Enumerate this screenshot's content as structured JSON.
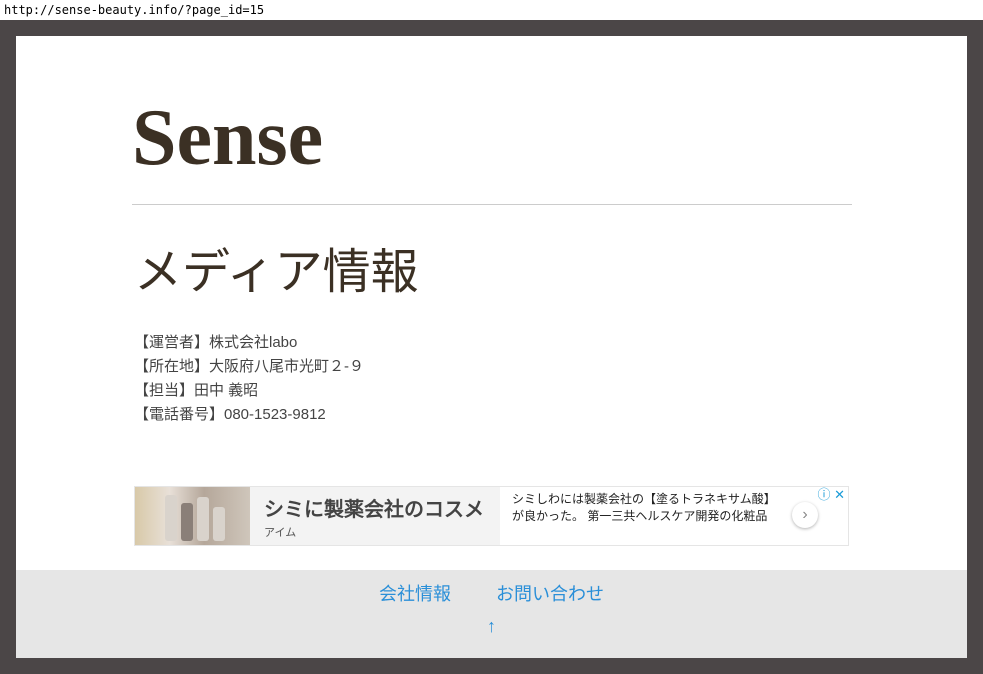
{
  "url": "http://sense-beauty.info/?page_id=15",
  "site_title": "Sense",
  "page_title": "メディア情報",
  "info_lines": [
    "【運営者】株式会社labo",
    "【所在地】大阪府八尾市光町２-９",
    "【担当】田中 義昭",
    "【電話番号】080-1523-9812"
  ],
  "ad": {
    "headline": "シミに製薬会社のコスメ",
    "advertiser": "アイム",
    "description": "シミしわには製薬会社の【塗るトラネキサム酸】が良かった。 第一三共ヘルスケア開発の化粧品",
    "arrow": "›",
    "info_icon": "ⓘ",
    "close_icon": "✕"
  },
  "footer": {
    "links": [
      "会社情報",
      "お問い合わせ"
    ],
    "top_link": "↑"
  }
}
